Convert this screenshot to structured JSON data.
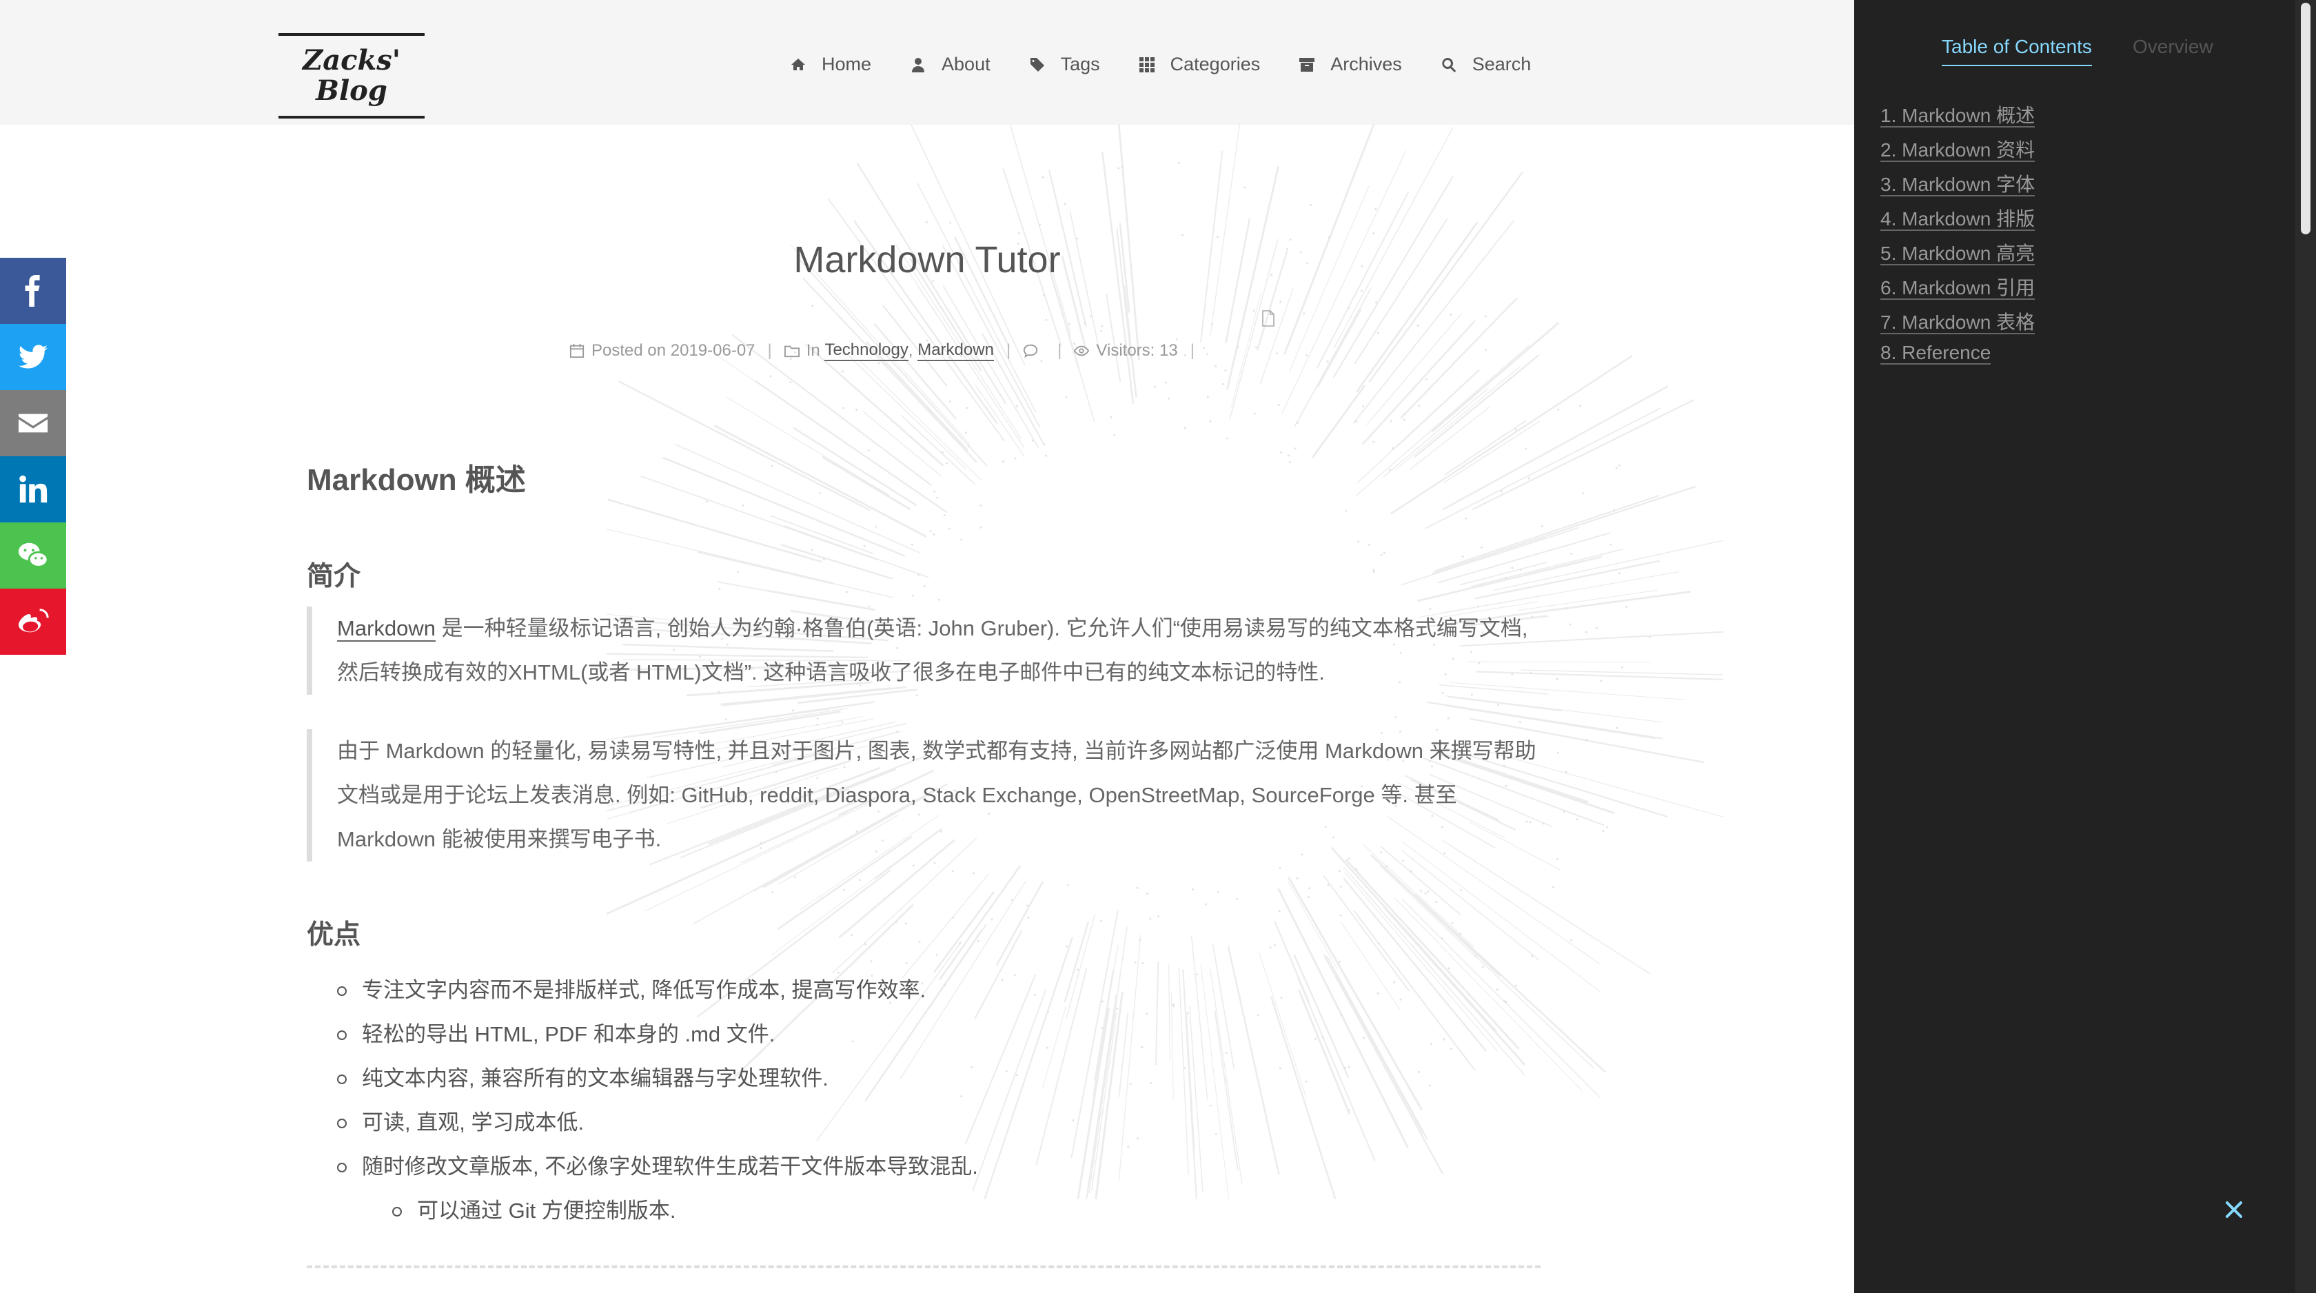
{
  "header": {
    "logo": "Zacks' Blog",
    "nav": [
      {
        "icon": "home-icon",
        "label": "Home"
      },
      {
        "icon": "user-icon",
        "label": "About"
      },
      {
        "icon": "tags-icon",
        "label": "Tags"
      },
      {
        "icon": "grid-icon",
        "label": "Categories"
      },
      {
        "icon": "archive-icon",
        "label": "Archives"
      },
      {
        "icon": "search-icon",
        "label": "Search"
      }
    ]
  },
  "share": [
    {
      "icon": "facebook-icon",
      "color": "#3b5998"
    },
    {
      "icon": "twitter-icon",
      "color": "#1da1f2"
    },
    {
      "icon": "email-icon",
      "color": "#7d7d7d"
    },
    {
      "icon": "linkedin-icon",
      "color": "#0077b5"
    },
    {
      "icon": "wechat-icon",
      "color": "#4cc34f"
    },
    {
      "icon": "weibo-icon",
      "color": "#e6162d"
    }
  ],
  "post": {
    "title": "Markdown Tutor",
    "meta": {
      "posted_label": "Posted on",
      "date": "2019-06-07",
      "in_label": "In",
      "category1": "Technology",
      "comma": ",",
      "category2": "Markdown",
      "visitors_label": "Visitors:",
      "visitors": "13"
    },
    "section_title": "Markdown 概述",
    "intro_heading": "简介",
    "quote1_link": "Markdown",
    "quote1_rest": " 是一种轻量级标记语言, 创始人为约翰·格鲁伯(英语: John Gruber). 它允许人们“使用易读易写的纯文本格式编写文档, 然后转换成有效的XHTML(或者 HTML)文档”. 这种语言吸收了很多在电子邮件中已有的纯文本标记的特性.",
    "quote2": "由于 Markdown 的轻量化, 易读易写特性, 并且对于图片, 图表, 数学式都有支持, 当前许多网站都广泛使用 Markdown 来撰写帮助文档或是用于论坛上发表消息. 例如: GitHub, reddit, Diaspora, Stack Exchange, OpenStreetMap, SourceForge 等. 甚至 Markdown 能被使用来撰写电子书.",
    "pros_heading": "优点",
    "pros": [
      "专注文字内容而不是排版样式, 降低写作成本, 提高写作效率.",
      "轻松的导出 HTML, PDF 和本身的 .md 文件.",
      "纯文本内容, 兼容所有的文本编辑器与字处理软件.",
      "可读, 直观, 学习成本低.",
      "随时修改文章版本, 不必像字处理软件生成若干文件版本导致混乱."
    ],
    "pros_sub": "可以通过 Git 方便控制版本."
  },
  "sidebar": {
    "tab_toc": "Table of Contents",
    "tab_overview": "Overview",
    "toc": [
      "1. Markdown 概述",
      "2. Markdown 资料",
      "3. Markdown 字体",
      "4. Markdown 排版",
      "5. Markdown 高亮",
      "6. Markdown 引用",
      "7. Markdown 表格",
      "8. Reference"
    ],
    "accent": "#87daff"
  }
}
